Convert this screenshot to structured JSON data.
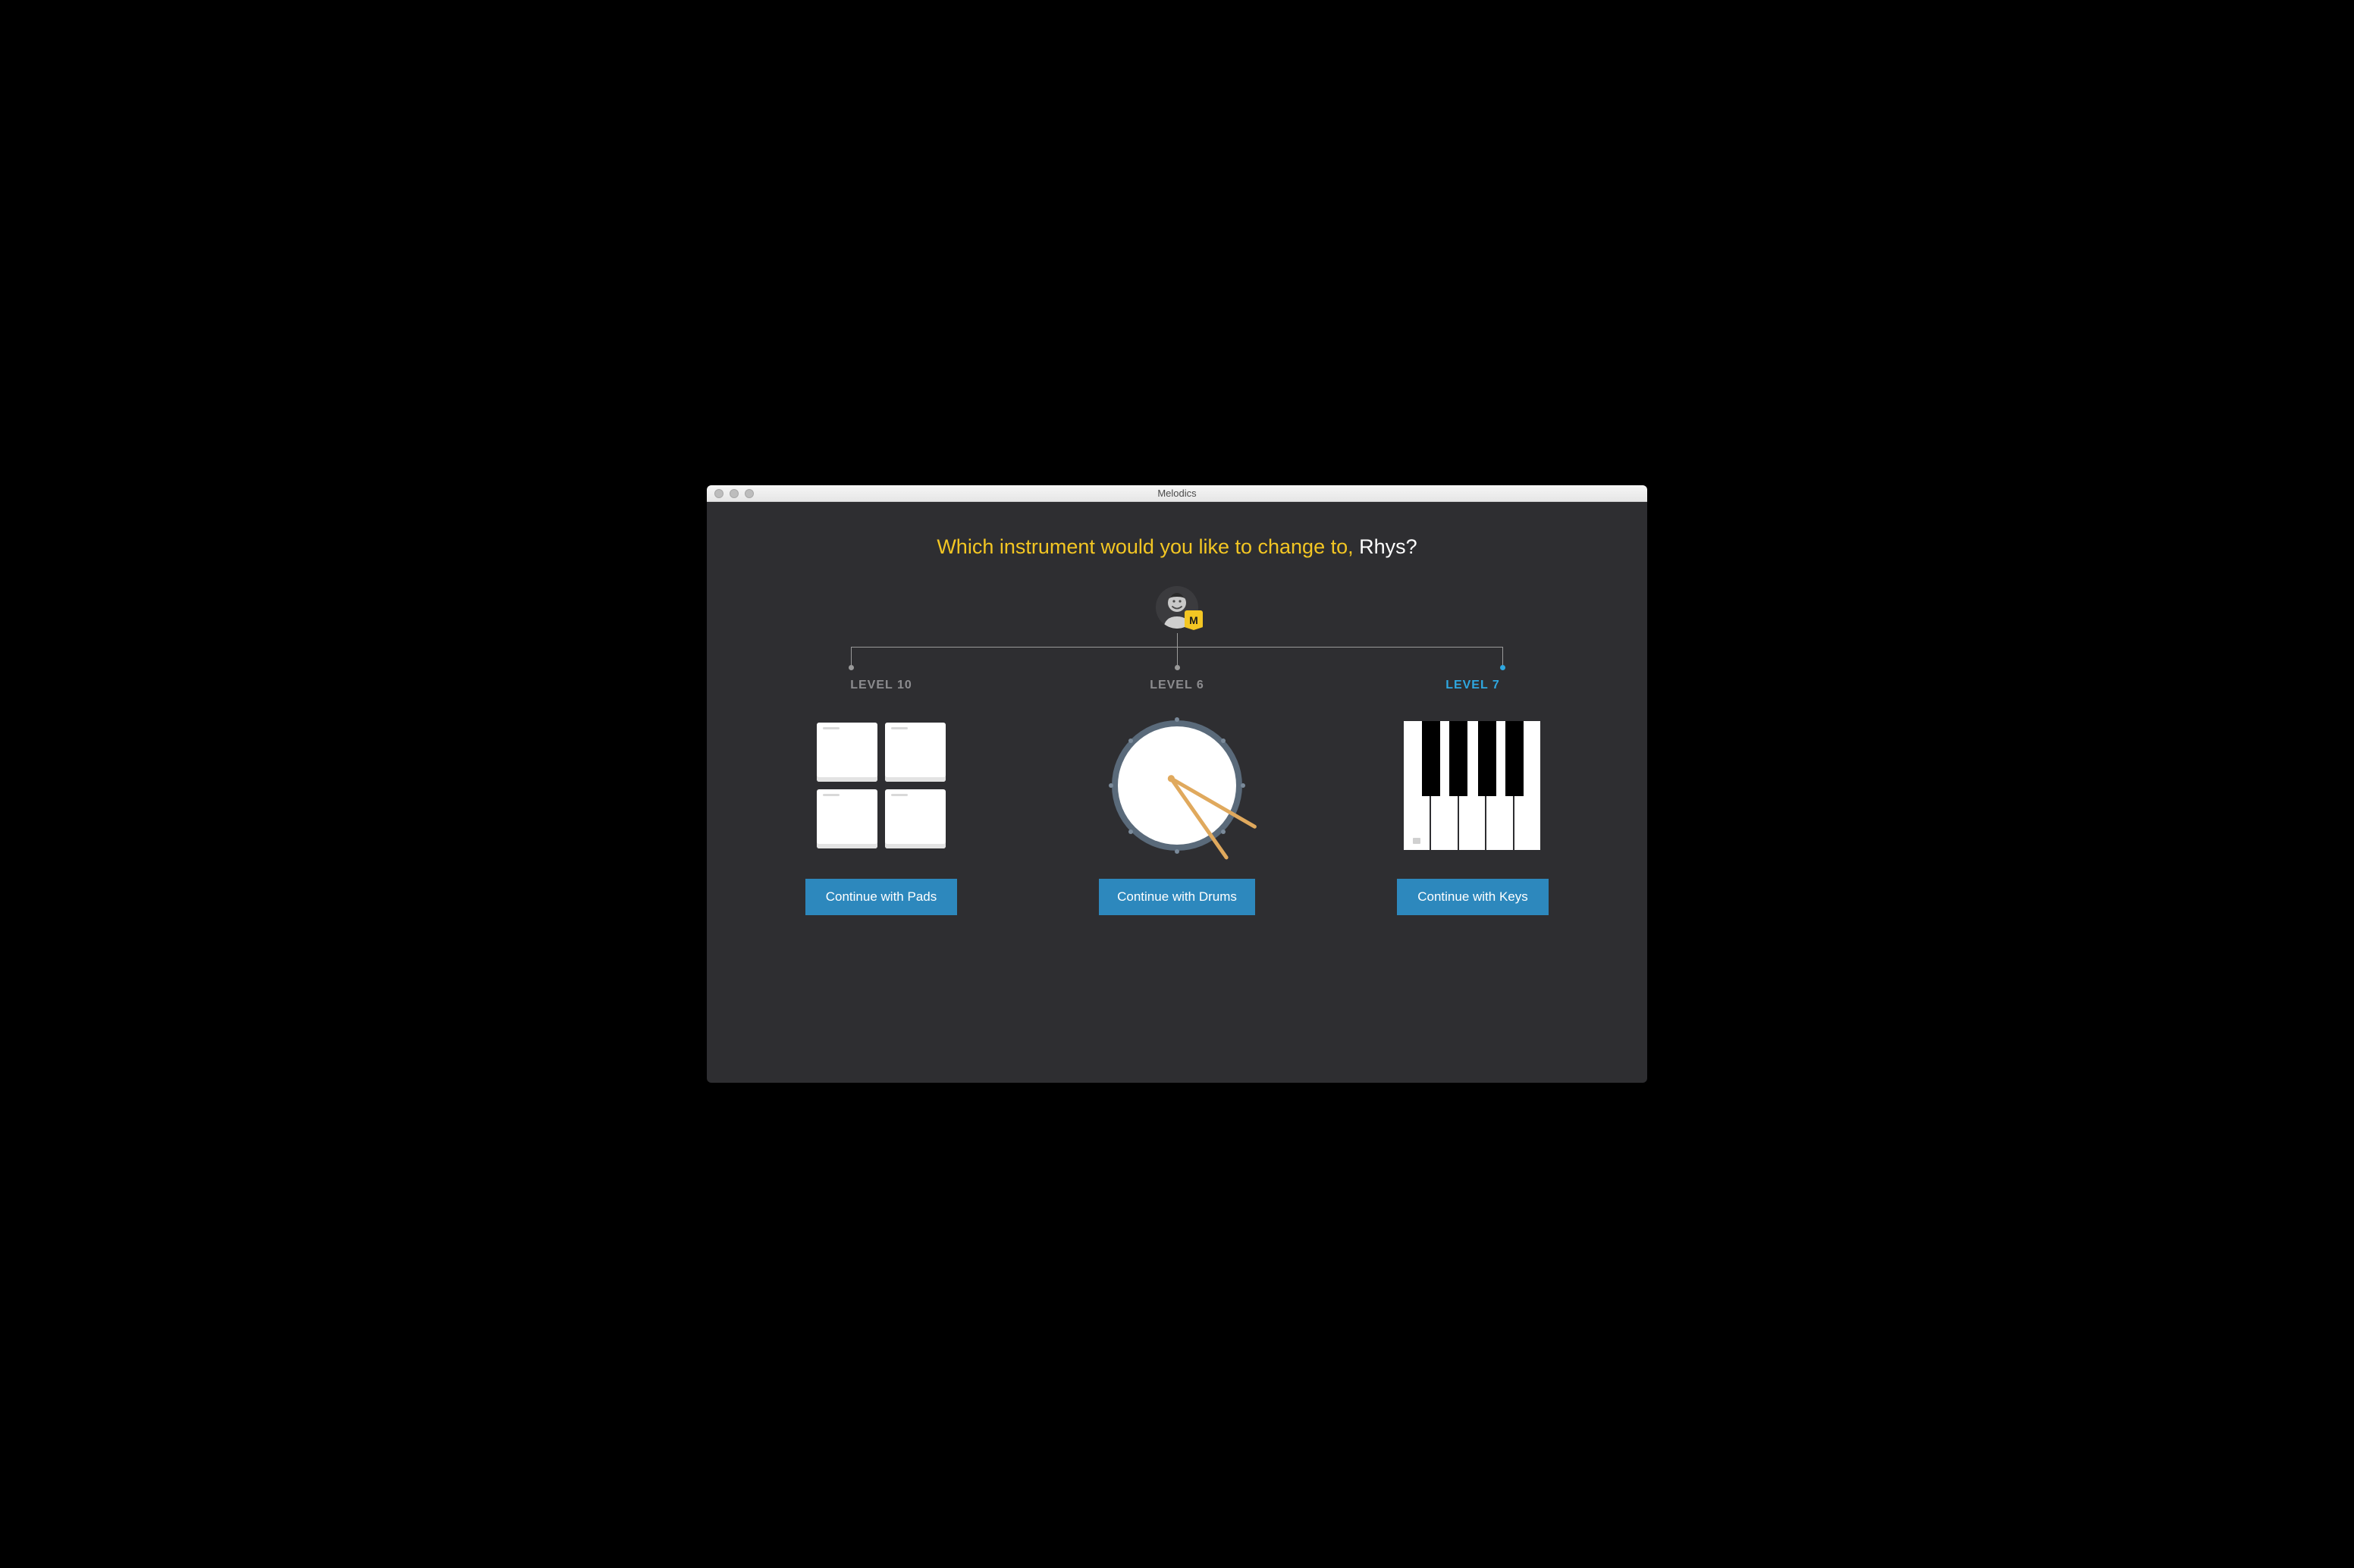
{
  "window": {
    "title": "Melodics"
  },
  "avatar_badge": "M",
  "heading": {
    "question": "Which instrument would you like to change to, ",
    "name": "Rhys?"
  },
  "instruments": [
    {
      "id": "pads",
      "level_label": "LEVEL 10",
      "button_label": "Continue with Pads",
      "active": false
    },
    {
      "id": "drums",
      "level_label": "LEVEL 6",
      "button_label": "Continue with Drums",
      "active": false
    },
    {
      "id": "keys",
      "level_label": "LEVEL 7",
      "button_label": "Continue with Keys",
      "active": true
    }
  ]
}
